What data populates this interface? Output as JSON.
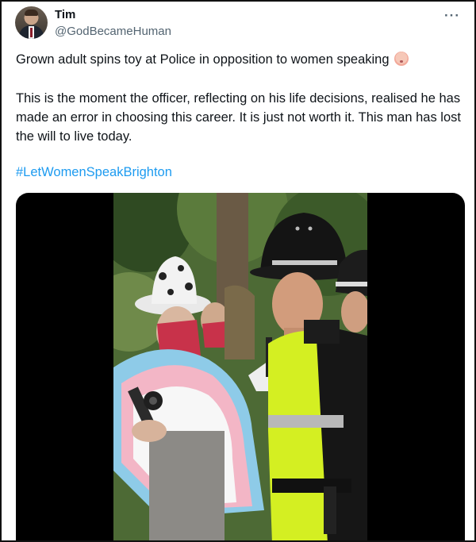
{
  "tweet": {
    "display_name": "Tim",
    "handle": "@GodBecameHuman",
    "more_label": "···",
    "text_line1": "Grown adult spins toy at Police in opposition to women speaking",
    "text_paragraph2": "This is the moment the officer, reflecting on his life decisions, realised he has made an error in choosing this career. It is just not worth it. This man has lost the will to live today.",
    "hashtag": "#LetWomenSpeakBrighton"
  },
  "icons": {
    "more": "more-horizontal-icon",
    "emoji": "baby-face-emoji"
  },
  "colors": {
    "link": "#1d9bf0",
    "secondary_text": "#536471",
    "primary_text": "#0f1419",
    "media_background": "#000000"
  }
}
